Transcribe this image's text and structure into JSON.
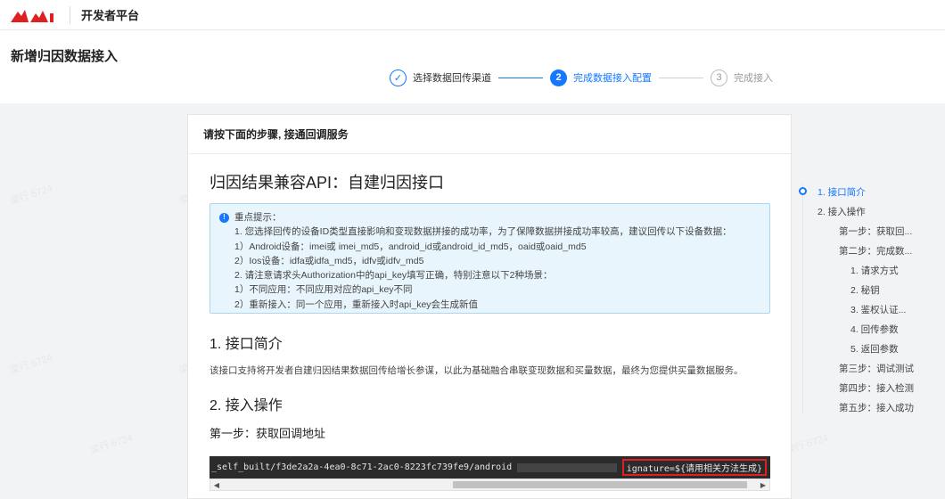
{
  "topnav": {
    "brand": "开发者平台",
    "logo_color": "#e02020"
  },
  "page": {
    "title": "新增归因数据接入"
  },
  "steps": [
    {
      "label": "选择数据回传渠道",
      "status": "done",
      "marker": "✓"
    },
    {
      "label": "完成数据接入配置",
      "status": "active",
      "marker": "2"
    },
    {
      "label": "完成接入",
      "status": "pending",
      "marker": "3"
    }
  ],
  "card": {
    "header": "请按下面的步骤, 接通回调服务",
    "doc_title": "归因结果兼容API：自建归因接口",
    "notice": {
      "title": "重点提示：",
      "lines": [
        "1. 您选择回传的设备ID类型直接影响和变现数据拼接的成功率，为了保障数据拼接成功率较高，建议回传以下设备数据：",
        "1）Android设备：imei或 imei_md5，android_id或android_id_md5，oaid或oaid_md5",
        "2）Ios设备：idfa或idfa_md5，idfv或idfv_md5",
        "2. 请注意请求头Authorization中的api_key填写正确，特别注意以下2种场景：",
        "1）不同应用：不同应用对应的api_key不同",
        "2）重新接入：同一个应用，重新接入时api_key会生成新值"
      ]
    },
    "section1": "1. 接口简介",
    "section1_desc": "该接口支持将开发者自建归因结果数据回传给增长参谋，以此为基础融合串联变现数据和买量数据，最终为您提供买量数据服务。",
    "section2": "2. 接入操作",
    "step1_title": "第一步：获取回调地址",
    "code_left": "_self_built/f3de2a2a-4ea0-8c71-2ac0-8223fc739fe9/android",
    "code_right": "ignature=${请用相关方法生成}"
  },
  "anchor_nav": [
    {
      "label": "1. 接口简介",
      "active": true
    },
    {
      "label": "2. 接入操作"
    },
    {
      "label": "第一步：获取回..."
    },
    {
      "label": "第二步：完成数..."
    },
    {
      "label": "1. 请求方式"
    },
    {
      "label": "2. 秘钥"
    },
    {
      "label": "3. 鉴权认证..."
    },
    {
      "label": "4. 回传参数"
    },
    {
      "label": "5. 返回参数"
    },
    {
      "label": "第三步：调试测试"
    },
    {
      "label": "第四步：接入检测"
    },
    {
      "label": "第五步：接入成功"
    }
  ],
  "watermark": "梁行 6724",
  "colors": {
    "accent": "#1677ff",
    "notice_bg": "#e9f5fd",
    "highlight": "#e02020"
  }
}
